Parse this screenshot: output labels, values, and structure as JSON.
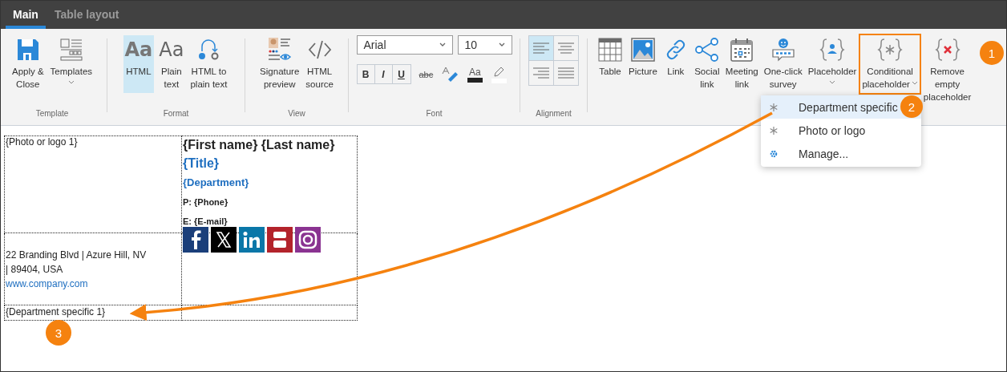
{
  "tabs": [
    {
      "label": "Main",
      "selected": true
    },
    {
      "label": "Table layout",
      "selected": false
    }
  ],
  "ribbon": [
    {
      "kind": "buttons",
      "label": "Template",
      "buttons": [
        {
          "label": "Apply &\nClose",
          "dropdown": false,
          "selected": false
        },
        {
          "label": "Templates",
          "dropdown": true,
          "selected": false
        }
      ]
    },
    {
      "kind": "buttons",
      "label": "Format",
      "buttons": [
        {
          "label": "HTML",
          "glyph": "Aa",
          "dropdown": false,
          "selected": true
        },
        {
          "label": "Plain\ntext",
          "glyph": "Aa",
          "dropdown": false,
          "selected": false
        },
        {
          "label": "HTML to\nplain text",
          "dropdown": false,
          "selected": false
        }
      ]
    },
    {
      "kind": "buttons",
      "label": "View",
      "buttons": [
        {
          "label": "Signature\npreview",
          "dropdown": false,
          "selected": false
        },
        {
          "label": "HTML\nsource",
          "dropdown": false,
          "selected": false
        }
      ]
    },
    {
      "kind": "font",
      "label": "Font",
      "font": {
        "value": "Arial"
      },
      "size": {
        "value": "10"
      },
      "styles": [
        "B",
        "I",
        "U",
        "abc"
      ],
      "color_glyph": "Aa"
    },
    {
      "kind": "alignment",
      "label": "Alignment",
      "options": [
        {
          "selected": true
        },
        {
          "selected": false
        },
        {
          "selected": false
        },
        {
          "selected": false
        }
      ]
    },
    {
      "kind": "buttons",
      "buttons": [
        {
          "label": "Table",
          "dropdown": false,
          "selected": false
        },
        {
          "label": "Picture",
          "dropdown": false,
          "selected": false
        },
        {
          "label": "Link",
          "dropdown": false,
          "selected": false
        },
        {
          "label": "Social\nlink",
          "dropdown": false,
          "selected": false
        },
        {
          "label": "Meeting\nlink",
          "dropdown": false,
          "selected": false
        },
        {
          "label": "One-click\nsurvey",
          "dropdown": false,
          "selected": false
        },
        {
          "label": "Placeholder",
          "dropdown": true,
          "selected": false
        },
        {
          "label": "Conditional\nplaceholder",
          "dropdown": true,
          "selected": false,
          "highlighted": true
        },
        {
          "label": "Remove\nempty\nplaceholder",
          "dropdown": false,
          "selected": false
        }
      ]
    }
  ],
  "menu": [
    {
      "kind": "placeholder",
      "label": "Department specific",
      "selected": true
    },
    {
      "kind": "placeholder",
      "label": "Photo or logo",
      "selected": false
    },
    {
      "kind": "command",
      "label": "Manage...",
      "selected": false
    }
  ],
  "signature": {
    "photo": "{Photo or logo 1}",
    "details": [
      {
        "kind": "name",
        "text": "{First name} {Last name}"
      },
      {
        "kind": "title",
        "text": "{Title}"
      },
      {
        "kind": "department",
        "text": "{Department}"
      },
      {
        "kind": "contact",
        "text": "P: {Phone}"
      },
      {
        "kind": "contact",
        "text": "E: {E-mail}"
      }
    ],
    "address": [
      "22 Branding Blvd | Azure Hill, NV",
      "| 89404, USA"
    ],
    "website": "www.company.com",
    "social": [
      {
        "color": "#1b3f7a"
      },
      {
        "color": "#000000"
      },
      {
        "color": "#0a77a8"
      },
      {
        "color": "#b3232b"
      },
      {
        "color": "#8a3391"
      }
    ],
    "footer": "{Department specific 1}"
  },
  "callouts": [
    "1",
    "2",
    "3"
  ]
}
